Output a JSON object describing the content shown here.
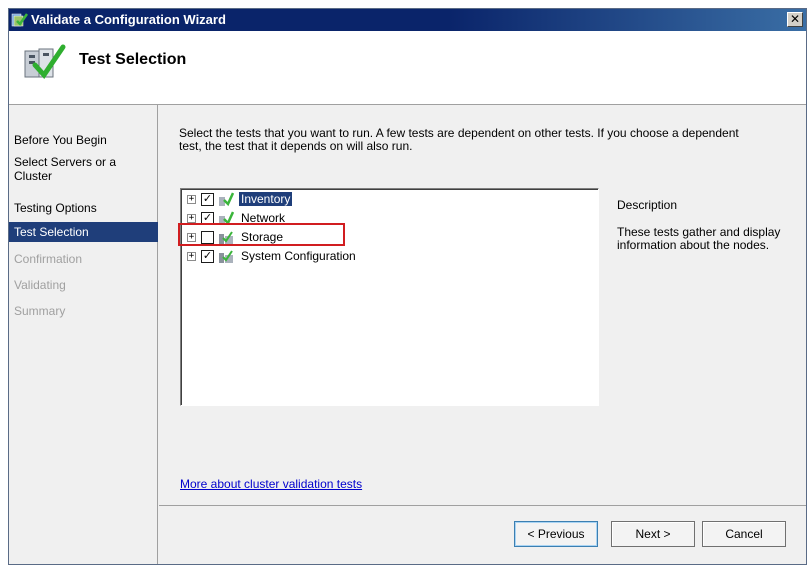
{
  "window": {
    "title": "Validate a Configuration Wizard",
    "close_glyph": "✕"
  },
  "header": {
    "title": "Test Selection",
    "icon": "wizard-checkmark-icon"
  },
  "steps": [
    {
      "label": "Before You Begin",
      "state": "done"
    },
    {
      "label": "Select Servers or a Cluster",
      "state": "done"
    },
    {
      "label": "Testing Options",
      "state": "done"
    },
    {
      "label": "Test Selection",
      "state": "active"
    },
    {
      "label": "Confirmation",
      "state": "disabled"
    },
    {
      "label": "Validating",
      "state": "disabled"
    },
    {
      "label": "Summary",
      "state": "disabled"
    }
  ],
  "main": {
    "instructions": "Select the tests that you want to run. A few tests are dependent on other tests. If you choose a dependent test, the test that it depends on will also run.",
    "tree": [
      {
        "label": "Inventory",
        "checked": true,
        "selected": true,
        "expander": "+",
        "icon": "inventory-tests-icon"
      },
      {
        "label": "Network",
        "checked": true,
        "selected": false,
        "expander": "+",
        "icon": "network-tests-icon"
      },
      {
        "label": "Storage",
        "checked": false,
        "selected": false,
        "expander": "+",
        "icon": "storage-tests-icon"
      },
      {
        "label": "System Configuration",
        "checked": true,
        "selected": false,
        "expander": "+",
        "icon": "system-configuration-tests-icon"
      }
    ],
    "description_heading": "Description",
    "description_text": "These tests gather and display information about the nodes.",
    "more_link": "More about cluster validation tests"
  },
  "buttons": {
    "previous": "< Previous",
    "next": "Next >",
    "cancel": "Cancel"
  },
  "colors": {
    "accent": "#1f3e7a",
    "highlight_box": "#d11d20",
    "link": "#0000cc"
  }
}
